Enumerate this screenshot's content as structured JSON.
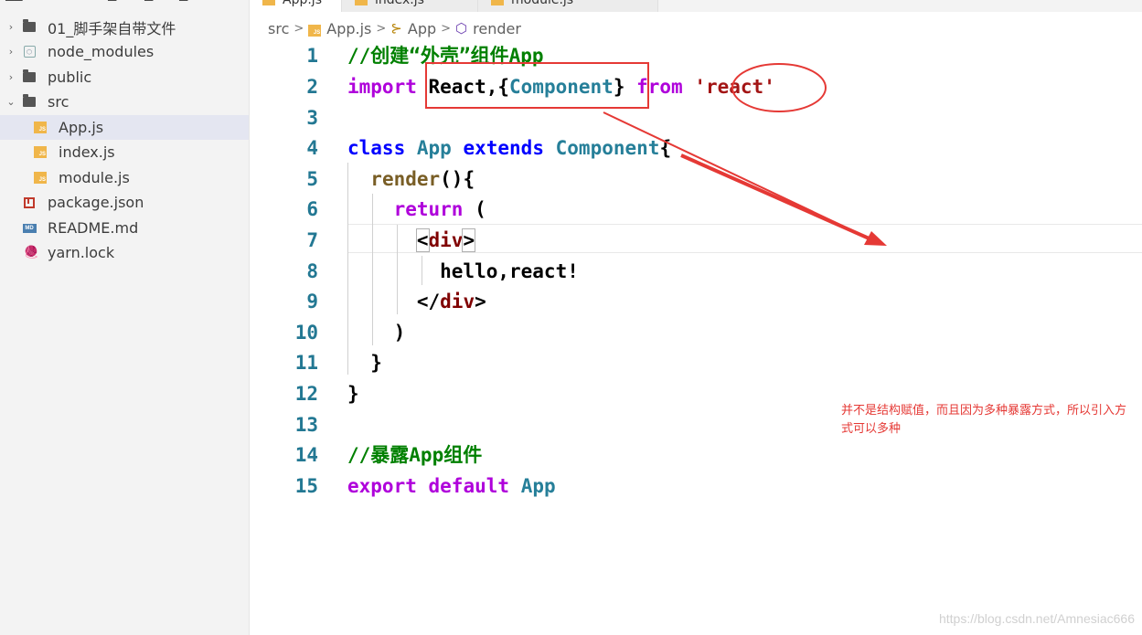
{
  "explorer": {
    "items": [
      {
        "label": "01_脚手架自带文件",
        "kind": "folder",
        "chevron": "›",
        "icon": "folder-icon"
      },
      {
        "label": "node_modules",
        "kind": "node",
        "chevron": "›",
        "icon": "node-modules-icon"
      },
      {
        "label": "public",
        "kind": "folder",
        "chevron": "›",
        "icon": "folder-icon"
      },
      {
        "label": "src",
        "kind": "folder",
        "chevron": "⌄",
        "icon": "folder-open-icon"
      },
      {
        "label": "App.js",
        "kind": "js",
        "icon": "js-file-icon"
      },
      {
        "label": "index.js",
        "kind": "js",
        "icon": "js-file-icon"
      },
      {
        "label": "module.js",
        "kind": "js",
        "icon": "js-file-icon"
      },
      {
        "label": "package.json",
        "kind": "pkg",
        "icon": "npm-icon"
      },
      {
        "label": "README.md",
        "kind": "md",
        "icon": "markdown-icon"
      },
      {
        "label": "yarn.lock",
        "kind": "yarn",
        "icon": "yarn-icon"
      }
    ]
  },
  "tabs": [
    {
      "label": "App.js"
    },
    {
      "label": "index.js"
    },
    {
      "label": "module.js"
    }
  ],
  "breadcrumb": {
    "folder": "src",
    "file": "App.js",
    "class_name": "App",
    "method": "render",
    "js_badge": "JS",
    "class_icon": "⊱",
    "method_icon": "⬡"
  },
  "code": {
    "line_numbers": [
      "1",
      "2",
      "3",
      "4",
      "5",
      "6",
      "7",
      "8",
      "9",
      "10",
      "11",
      "12",
      "13",
      "14",
      "15"
    ]
  },
  "annotation": {
    "note": "并不是结构赋值，而且因为多种暴露方式，所以引入方式可以多种"
  },
  "watermark": "https://blog.csdn.net/Amnesiac666",
  "colors": {
    "keyword": "#af00db",
    "keyword_blue": "#0000ff",
    "class": "#267f99",
    "function": "#795e26",
    "string": "#a31515",
    "comment": "#008000",
    "annotation": "#e53935",
    "line_number": "#237893"
  }
}
